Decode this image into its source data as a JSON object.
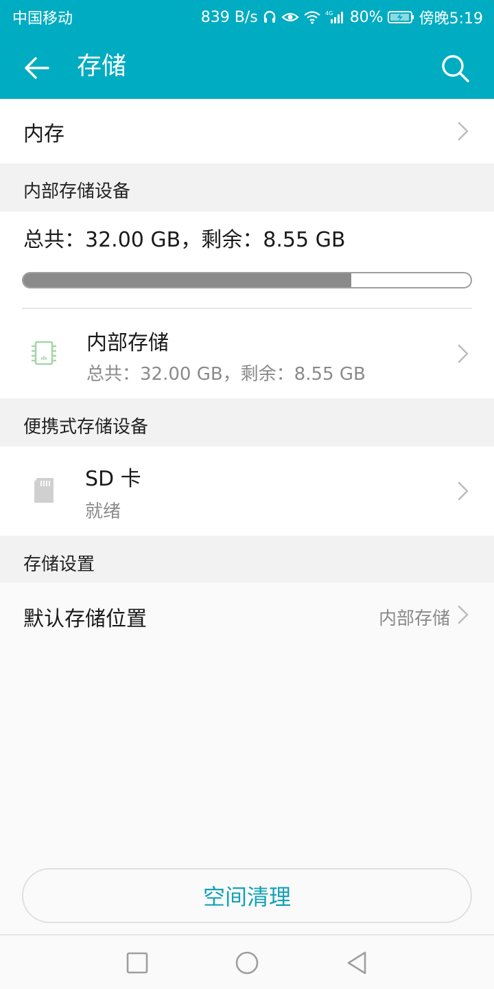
{
  "status_bar": {
    "carrier": "中国移动",
    "speed": "839 B/s",
    "battery": "80%",
    "time": "傍晚5:19",
    "icons": [
      "headset-icon",
      "eye-icon",
      "wifi-icon",
      "4g-signal-icon",
      "battery-charging-icon"
    ]
  },
  "app_bar": {
    "title": "存储",
    "back_icon": "arrow-left-icon",
    "search_icon": "search-icon"
  },
  "memory_row": {
    "label": "内存"
  },
  "internal_section": {
    "header": "内部存储设备",
    "summary": "总共：32.00 GB，剩余：8.55 GB",
    "used_fraction": 0.733,
    "item": {
      "title": "内部存储",
      "subtitle": "总共：32.00 GB，剩余：8.55 GB",
      "icon": "chip-icon"
    }
  },
  "portable_section": {
    "header": "便携式存储设备",
    "item": {
      "title": "SD 卡",
      "subtitle": "就绪",
      "icon": "sd-card-icon"
    }
  },
  "settings_section": {
    "header": "存储设置",
    "default_location": {
      "label": "默认存储位置",
      "value": "内部存储"
    }
  },
  "clean_button": {
    "label": "空间清理"
  },
  "colors": {
    "primary": "#00acc1",
    "accent_text": "#14a2b4",
    "chip_green": "#a5d6a7"
  }
}
